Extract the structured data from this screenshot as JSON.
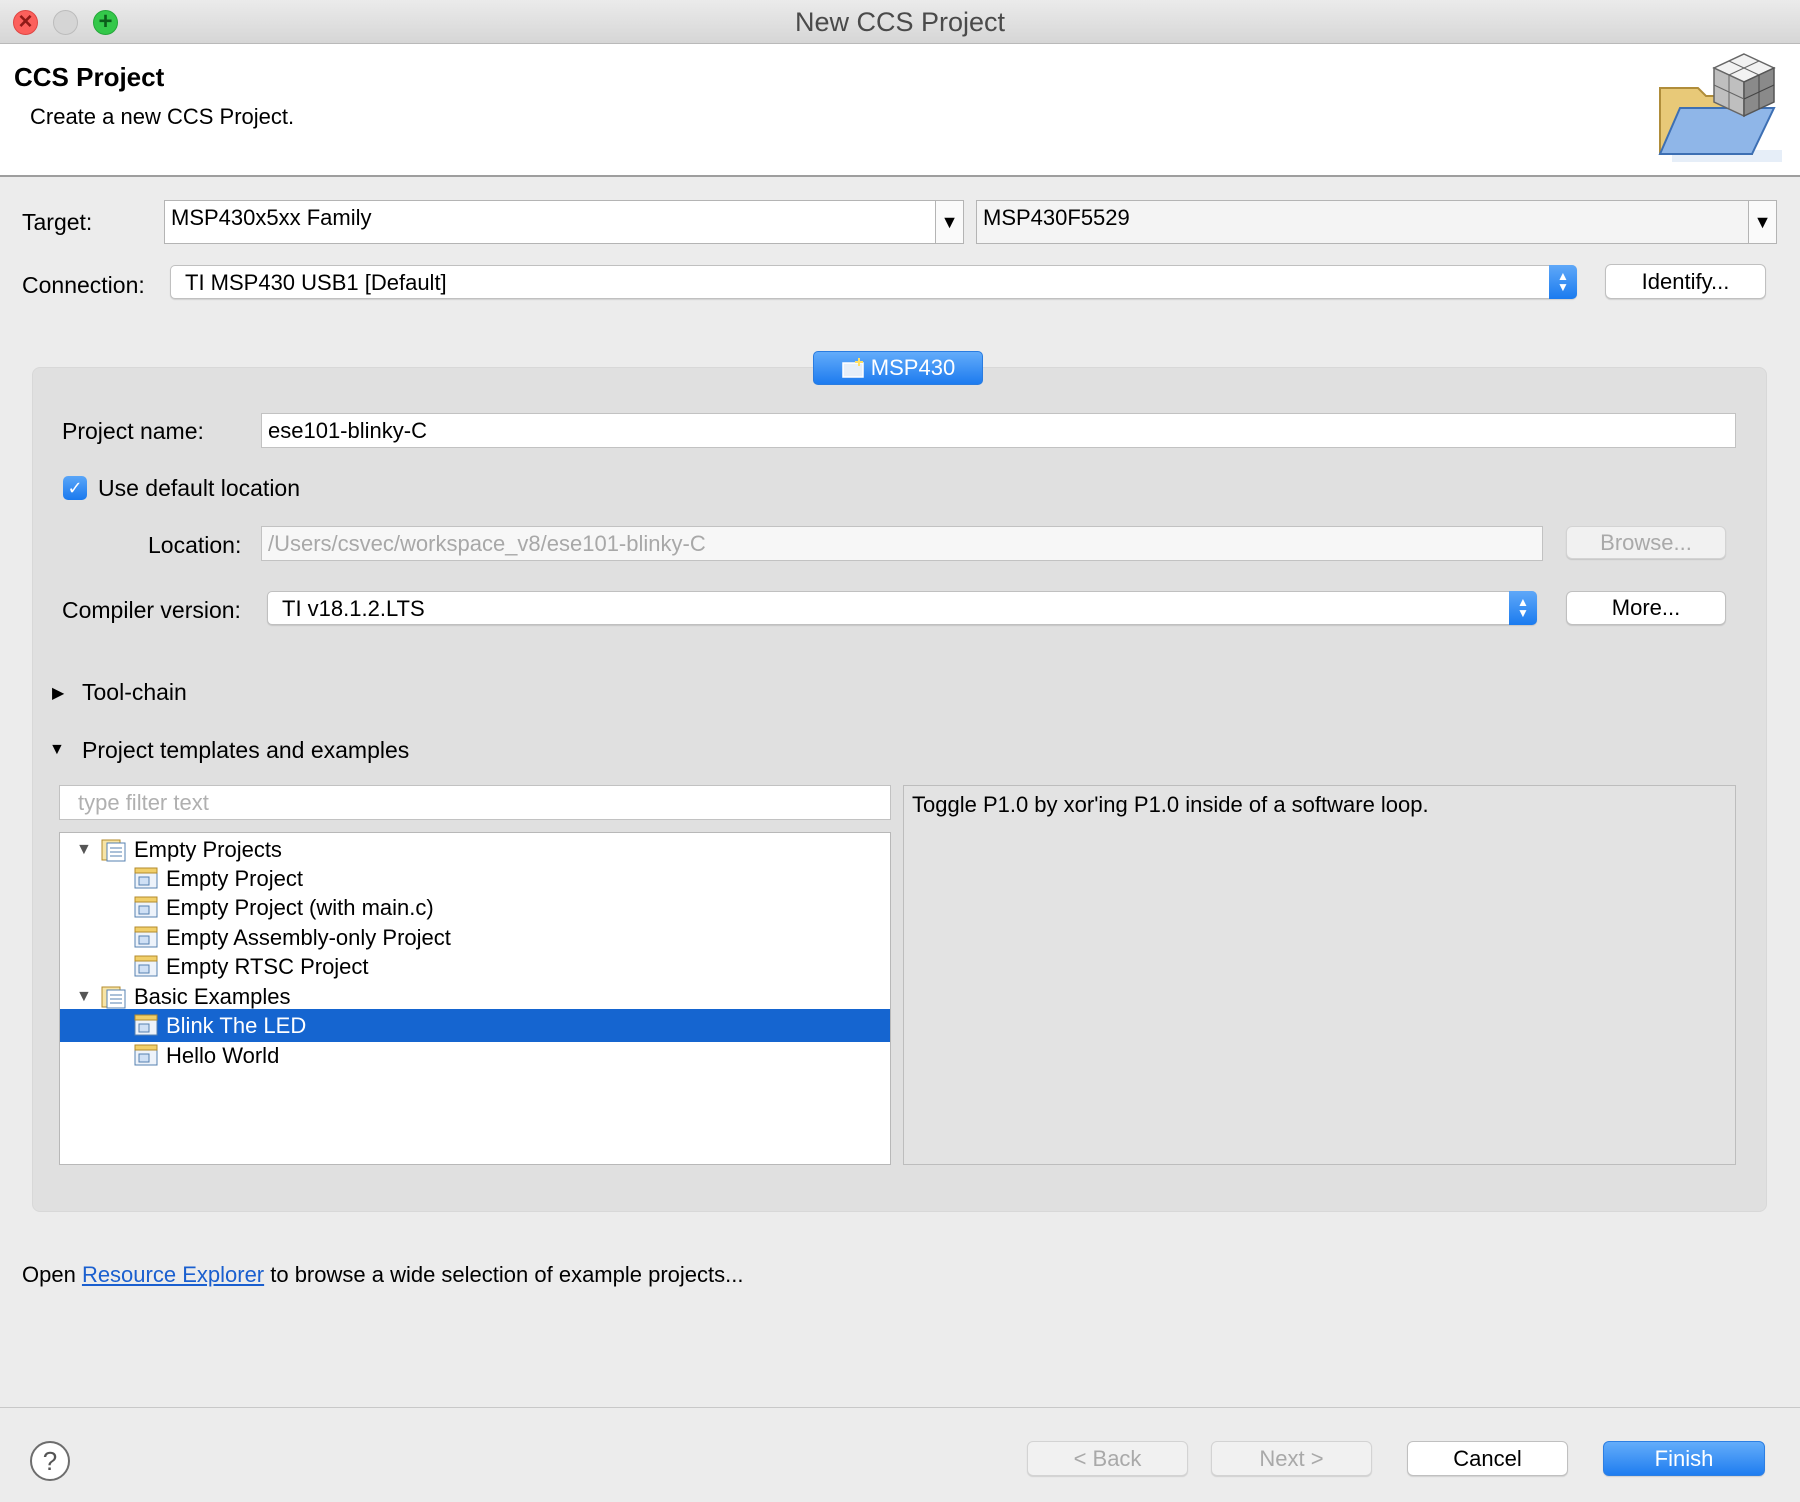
{
  "window": {
    "title": "New CCS Project"
  },
  "header": {
    "title": "CCS Project",
    "subtitle": "Create a new CCS Project."
  },
  "target": {
    "label": "Target:",
    "family": "MSP430x5xx Family",
    "device": "MSP430F5529"
  },
  "connection": {
    "label": "Connection:",
    "value": "TI MSP430 USB1 [Default]",
    "identify_label": "Identify..."
  },
  "platform_tab": {
    "label": "MSP430"
  },
  "project": {
    "name_label": "Project name:",
    "name_value": "ese101-blinky-C",
    "use_default_label": "Use default location",
    "use_default_checked": true,
    "location_label": "Location:",
    "location_value": "/Users/csvec/workspace_v8/ese101-blinky-C",
    "browse_label": "Browse...",
    "compiler_label": "Compiler version:",
    "compiler_value": "TI v18.1.2.LTS",
    "more_label": "More..."
  },
  "sections": {
    "toolchain": "Tool-chain",
    "templates": "Project templates and examples"
  },
  "templates": {
    "filter_placeholder": "type filter text",
    "description": "Toggle P1.0 by xor'ing P1.0 inside of a software loop.",
    "tree": [
      {
        "label": "Empty Projects",
        "level": 0
      },
      {
        "label": "Empty Project",
        "level": 1
      },
      {
        "label": "Empty Project (with main.c)",
        "level": 1
      },
      {
        "label": "Empty Assembly-only Project",
        "level": 1
      },
      {
        "label": "Empty RTSC Project",
        "level": 1
      },
      {
        "label": "Basic Examples",
        "level": 0
      },
      {
        "label": "Blink The LED",
        "level": 1,
        "selected": true
      },
      {
        "label": "Hello World",
        "level": 1
      }
    ]
  },
  "footer": {
    "prefix": "Open ",
    "link": "Resource Explorer",
    "suffix": " to browse a wide selection of example projects..."
  },
  "buttons": {
    "help": "?",
    "back": "< Back",
    "next": "Next >",
    "cancel": "Cancel",
    "finish": "Finish"
  },
  "colors": {
    "accent": "#1d7bef",
    "selection": "#1565d0",
    "link": "#1a5fcf"
  }
}
